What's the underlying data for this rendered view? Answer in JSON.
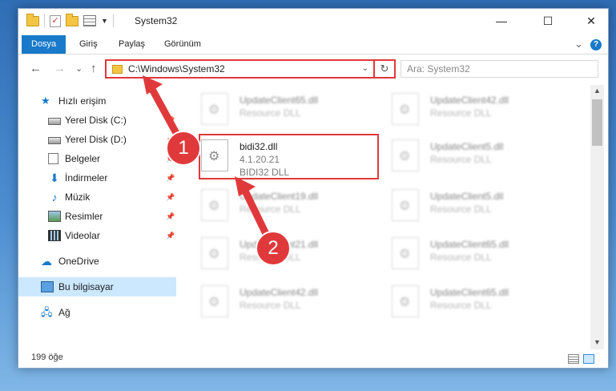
{
  "window": {
    "title": "System32",
    "controls": {
      "minimize": "—",
      "maximize": "☐",
      "close": "✕"
    }
  },
  "ribbon": {
    "tabs": [
      "Dosya",
      "Giriş",
      "Paylaş",
      "Görünüm"
    ],
    "expand_glyph": "⌄",
    "help_glyph": "?"
  },
  "nav": {
    "back_glyph": "←",
    "forward_glyph": "→",
    "recent_glyph": "⌄",
    "up_glyph": "↑",
    "address": "C:\\Windows\\System32",
    "address_chevron": "⌄",
    "refresh_glyph": "↻",
    "search_placeholder": "Ara: System32"
  },
  "sidebar": {
    "items": [
      {
        "label": "Hızlı erişim",
        "icon": "star-icon",
        "pinned": false
      },
      {
        "label": "Yerel Disk (C:)",
        "icon": "drive-icon",
        "pinned": true
      },
      {
        "label": "Yerel Disk (D:)",
        "icon": "drive-icon",
        "pinned": true
      },
      {
        "label": "Belgeler",
        "icon": "documents-icon",
        "pinned": true
      },
      {
        "label": "İndirmeler",
        "icon": "downloads-icon",
        "pinned": true
      },
      {
        "label": "Müzik",
        "icon": "music-icon",
        "pinned": true
      },
      {
        "label": "Resimler",
        "icon": "pictures-icon",
        "pinned": true
      },
      {
        "label": "Videolar",
        "icon": "videos-icon",
        "pinned": true
      },
      {
        "label": "OneDrive",
        "icon": "cloud-icon",
        "pinned": false
      },
      {
        "label": "Bu bilgisayar",
        "icon": "computer-icon",
        "pinned": false,
        "selected": true
      },
      {
        "label": "Ağ",
        "icon": "network-icon",
        "pinned": false
      }
    ],
    "pin_glyph": "📌"
  },
  "files": [
    {
      "name": "UpdateClient65.dll",
      "line1": "Resource DLL",
      "line2": "",
      "blurred": true
    },
    {
      "name": "UpdateClient42.dll",
      "line1": "Resource DLL",
      "line2": "",
      "blurred": true
    },
    {
      "name": "bidi32.dll",
      "line1": "4.1.20.21",
      "line2": "BIDI32 DLL",
      "blurred": false,
      "highlighted": true
    },
    {
      "name": "UpdateClient5.dll",
      "line1": "Resource DLL",
      "line2": "",
      "blurred": true
    },
    {
      "name": "UpdateClient19.dll",
      "line1": "Resource DLL",
      "line2": "",
      "blurred": true
    },
    {
      "name": "UpdateClient5.dll",
      "line1": "Resource DLL",
      "line2": "",
      "blurred": true
    },
    {
      "name": "UpdateClient21.dll",
      "line1": "Resource DLL",
      "line2": "",
      "blurred": true
    },
    {
      "name": "UpdateClient65.dll",
      "line1": "Resource DLL",
      "line2": "",
      "blurred": true
    },
    {
      "name": "UpdateClient42.dll",
      "line1": "Resource DLL",
      "line2": "",
      "blurred": true
    },
    {
      "name": "UpdateClient65.dll",
      "line1": "Resource DLL",
      "line2": "",
      "blurred": true
    }
  ],
  "status": {
    "item_count": "199 öğe"
  },
  "annotations": {
    "labels": [
      "1",
      "2"
    ],
    "color": "#e0393b"
  }
}
